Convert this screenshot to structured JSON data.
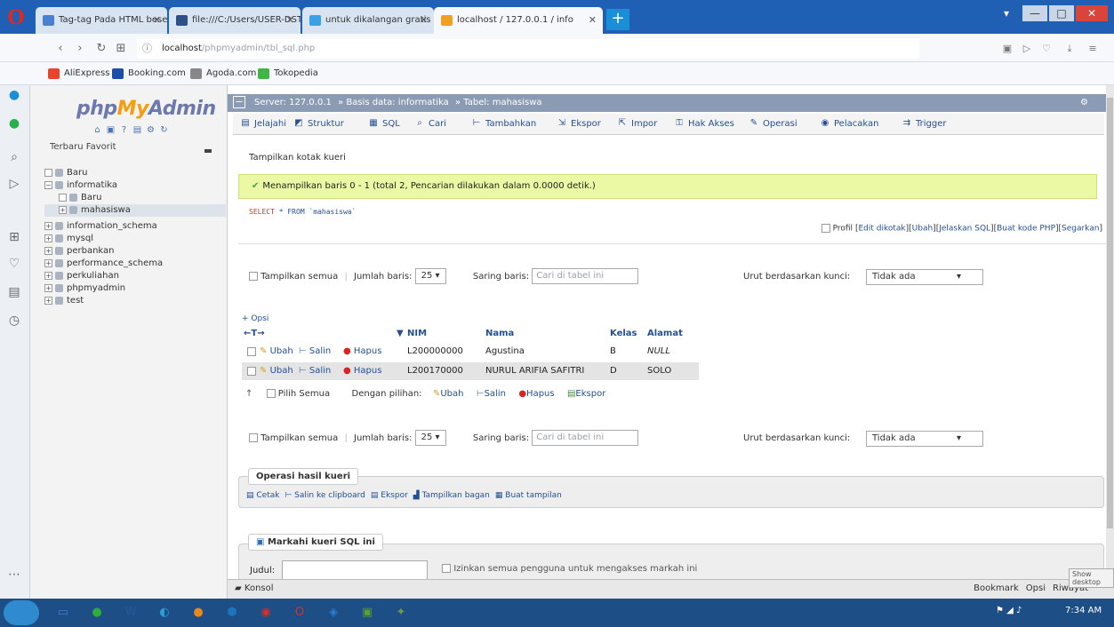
{
  "browser": {
    "tabs": [
      {
        "label": "Tag-tag Pada HTML beserta",
        "color": "#4a7fd1"
      },
      {
        "label": "file:///C:/Users/USER-DST/",
        "color": "#2d4f8a"
      },
      {
        "label": "untuk dikalangan gratis",
        "color": "#3aa0e8"
      },
      {
        "label": "localhost / 127.0.0.1 / info",
        "color": "#f0a020",
        "active": true
      }
    ],
    "new_tab": "+",
    "url_host": "localhost",
    "url_path": "/phpmyadmin/tbl_sql.php",
    "bookmarks": [
      {
        "label": "AliExpress",
        "color": "#e8452c"
      },
      {
        "label": "Booking.com",
        "color": "#1b4fa8"
      },
      {
        "label": "Agoda.com",
        "color": "#888888"
      },
      {
        "label": "Tokopedia",
        "color": "#42b549"
      }
    ]
  },
  "nav": {
    "logo_php": "php",
    "logo_my": "My",
    "logo_admin": "Admin",
    "recent": "Terbaru",
    "favorites": "Favorit",
    "tree": [
      {
        "label": "Baru",
        "level": 0,
        "exp": ""
      },
      {
        "label": "informatika",
        "level": 0,
        "exp": "−"
      },
      {
        "label": "Baru",
        "level": 1,
        "exp": ""
      },
      {
        "label": "mahasiswa",
        "level": 1,
        "exp": "+",
        "selected": true
      },
      {
        "label": "information_schema",
        "level": 0,
        "exp": "+"
      },
      {
        "label": "mysql",
        "level": 0,
        "exp": "+"
      },
      {
        "label": "perbankan",
        "level": 0,
        "exp": "+"
      },
      {
        "label": "performance_schema",
        "level": 0,
        "exp": "+"
      },
      {
        "label": "perkuliahan",
        "level": 0,
        "exp": "+"
      },
      {
        "label": "phpmyadmin",
        "level": 0,
        "exp": "+"
      },
      {
        "label": "test",
        "level": 0,
        "exp": "+"
      }
    ]
  },
  "breadcrumb": {
    "server": "Server: 127.0.0.1",
    "database": "Basis data: informatika",
    "table": "Tabel: mahasiswa"
  },
  "menu": [
    {
      "label": "Jelajahi",
      "icon": "▤"
    },
    {
      "label": "Struktur",
      "icon": "◩"
    },
    {
      "label": "SQL",
      "icon": "▦"
    },
    {
      "label": "Cari",
      "icon": "⌕"
    },
    {
      "label": "Tambahkan",
      "icon": "⊢"
    },
    {
      "label": "Ekspor",
      "icon": "⇲"
    },
    {
      "label": "Impor",
      "icon": "⇱"
    },
    {
      "label": "Hak Akses",
      "icon": "⚿"
    },
    {
      "label": "Operasi",
      "icon": "✎"
    },
    {
      "label": "Pelacakan",
      "icon": "◉"
    },
    {
      "label": "Trigger",
      "icon": "⇉"
    }
  ],
  "main": {
    "show_query_box": "Tampilkan kotak kueri",
    "success_msg": "Menampilkan baris 0 - 1 (total 2, Pencarian dilakukan dalam 0.0000 detik.)",
    "sql_kw": "SELECT",
    "sql_rest": "* FROM `mahasiswa`",
    "profile": "Profil",
    "profile_links": [
      "Edit dikotak",
      "Ubah",
      "Jelaskan SQL",
      "Buat kode PHP",
      "Segarkan"
    ],
    "show_all": "Tampilkan semua",
    "rows_label": "Jumlah baris:",
    "rows_value": "25",
    "filter_label": "Saring baris:",
    "filter_placeholder": "Cari di tabel ini",
    "sort_label": "Urut berdasarkan kunci:",
    "sort_value": "Tidak ada",
    "options": "+ Opsi",
    "columns": [
      "NIM",
      "Nama",
      "Kelas",
      "Alamat"
    ],
    "actions": {
      "edit": "Ubah",
      "copy": "Salin",
      "delete": "Hapus"
    },
    "rows": [
      {
        "nim": "L200000000",
        "nama": "Agustina",
        "kelas": "B",
        "alamat": "NULL"
      },
      {
        "nim": "L200170000",
        "nama": "NURUL ARIFIA SAFITRI",
        "kelas": "D",
        "alamat": "SOLO"
      }
    ],
    "check_all": "Pilih Semua",
    "with_selected": "Dengan pilihan:",
    "bulk": {
      "edit": "Ubah",
      "copy": "Salin",
      "delete": "Hapus",
      "export": "Ekspor"
    },
    "query_ops_title": "Operasi hasil kueri",
    "query_ops": [
      "Cetak",
      "Salin ke clipboard",
      "Ekspor",
      "Tampilkan bagan",
      "Buat tampilan"
    ],
    "bookmark_title": "Markahi kueri SQL ini",
    "label_field": "Judul:",
    "allow_users": "Izinkan semua pengguna untuk mengakses markah ini",
    "console": "Konsol",
    "console_links": [
      "Bookmark",
      "Opsi",
      "Riwayat"
    ],
    "show_desktop": "Show desktop"
  },
  "taskbar": {
    "time": "7:34 AM",
    "apps": [
      {
        "icon": "▭",
        "color": "#3c7fd0"
      },
      {
        "icon": "●",
        "color": "#2fae3a"
      },
      {
        "icon": "W",
        "color": "#2b5797"
      },
      {
        "icon": "◐",
        "color": "#2a9fd6"
      },
      {
        "icon": "●",
        "color": "#e88a1a"
      },
      {
        "icon": "⬢",
        "color": "#1e73be"
      },
      {
        "icon": "◉",
        "color": "#d93025"
      },
      {
        "icon": "O",
        "color": "#d93025"
      },
      {
        "icon": "◈",
        "color": "#2a7fd0"
      },
      {
        "icon": "▣",
        "color": "#5a9f3a"
      },
      {
        "icon": "✦",
        "color": "#6e9a40"
      }
    ]
  }
}
